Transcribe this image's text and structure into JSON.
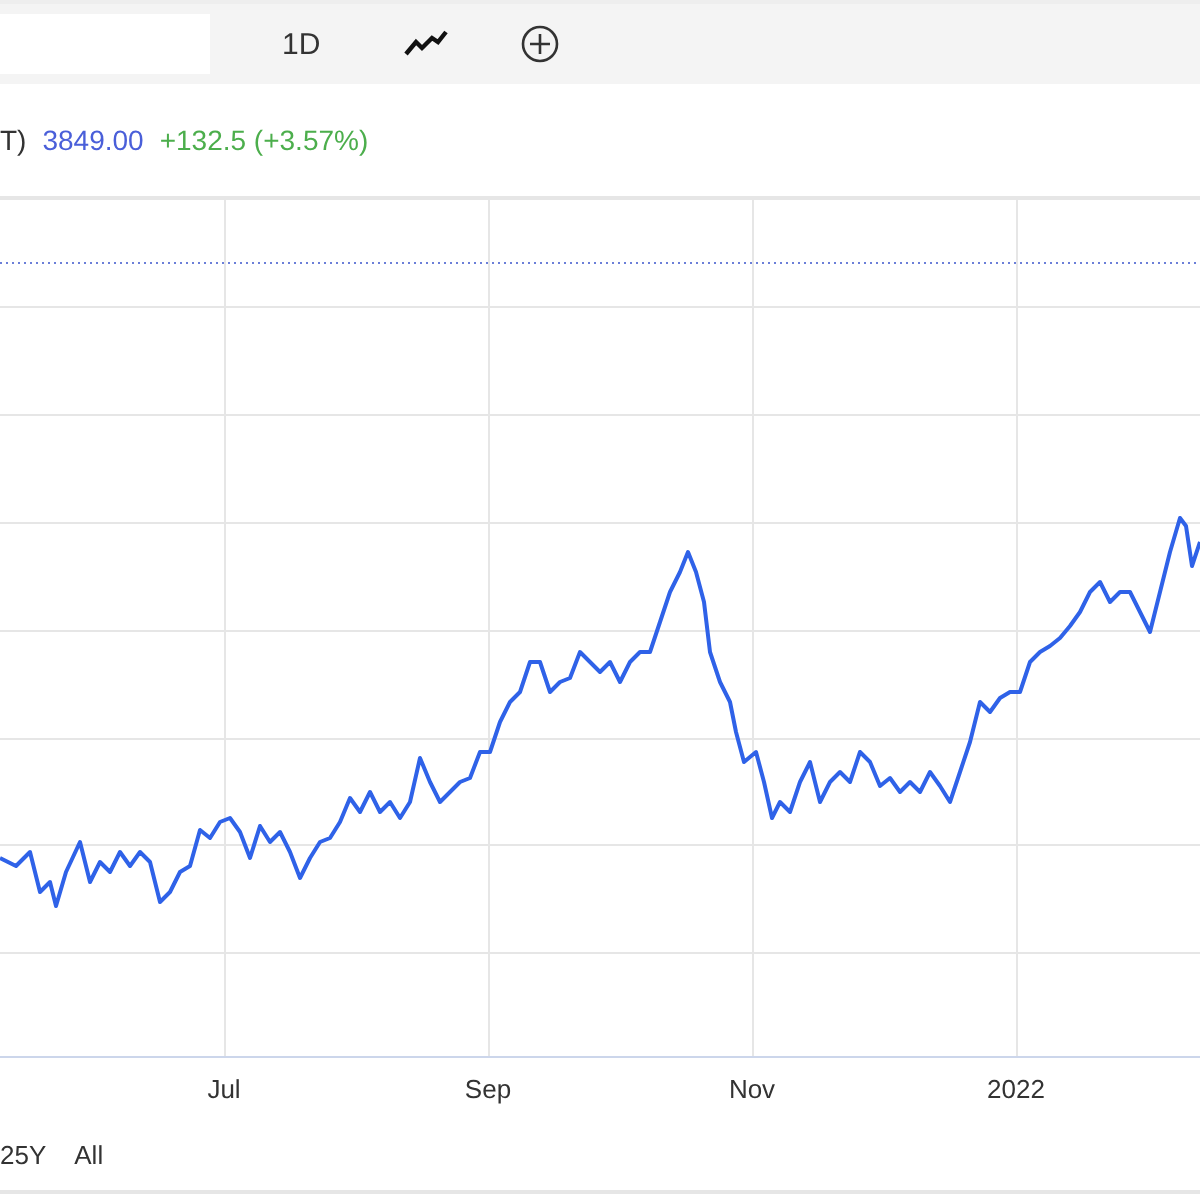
{
  "toolbar": {
    "interval": "1D"
  },
  "legend": {
    "symbol": "T)",
    "price": "3849.00",
    "change": "+132.5 (+3.57%)"
  },
  "chart": {
    "x_labels": [
      "Jul",
      "Sep",
      "Nov",
      "2022"
    ]
  },
  "ranges": [
    "25Y",
    "All"
  ]
}
